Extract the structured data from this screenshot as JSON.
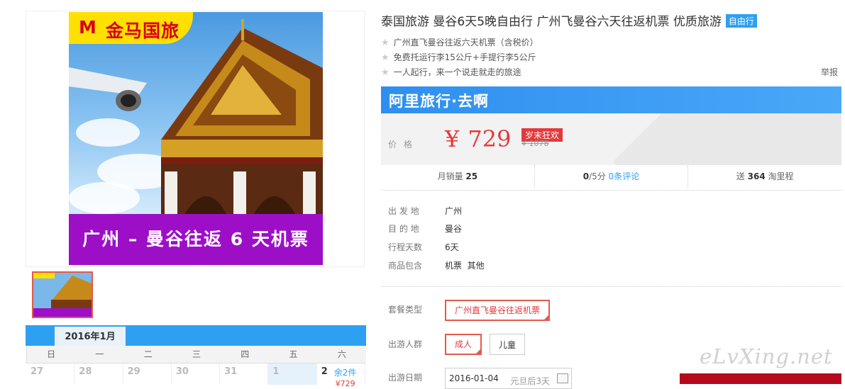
{
  "gallery": {
    "brand_logo": "M",
    "brand_name": "金马国旅",
    "banner_text": "广州 – 曼谷往返 6 天机票"
  },
  "calendar": {
    "month": "2016年1月",
    "weekdays": [
      "日",
      "一",
      "二",
      "三",
      "四",
      "五",
      "六"
    ],
    "days": [
      "27",
      "28",
      "29",
      "30",
      "31",
      "1",
      "2"
    ],
    "stock_label": "余2件",
    "price_label": "¥729"
  },
  "product": {
    "title": "泰国旅游 曼谷6天5晚自由行 广州飞曼谷六天往返机票 优质旅游",
    "tag": "自由行",
    "bullets": [
      "广州直飞曼谷往返六天机票（含税价）",
      "免费托运行李15公斤+手提行李5公斤",
      "一人起行，来一个说走就走的旅途"
    ],
    "report": "举报",
    "brand_banner": "阿里旅行·去啊"
  },
  "price": {
    "label": "价格",
    "currency": "¥",
    "value": "729",
    "promo": "岁末狂欢",
    "original": "¥ 1078"
  },
  "stats": {
    "sales_label": "月销量",
    "sales_value": "25",
    "score_value": "0",
    "score_total": "/5分",
    "reviews": "0条评论",
    "points_prefix": "送",
    "points_value": "364",
    "points_suffix": "淘里程"
  },
  "details": [
    {
      "label": "出 发 地",
      "value": "广州"
    },
    {
      "label": "目 的 地",
      "value": "曼谷"
    },
    {
      "label": "行程天数",
      "value": "6天"
    },
    {
      "label": "商品包含",
      "value": "机票  其他"
    }
  ],
  "options": {
    "package_label": "套餐类型",
    "package_value": "广州直飞曼谷往返机票",
    "group_label": "出游人群",
    "group_adult": "成人",
    "group_child": "儿童",
    "date_label": "出游日期",
    "date_value": "2016-01-04",
    "date_hint": "元旦后3天"
  },
  "watermark": "eLvXing.net"
}
